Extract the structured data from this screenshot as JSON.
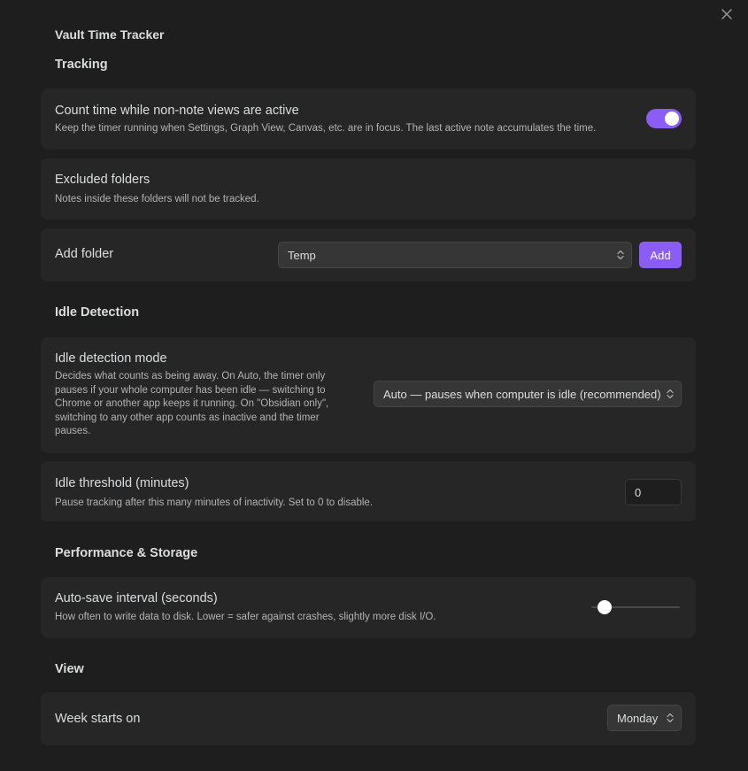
{
  "title": "Vault Time Tracker",
  "sections": {
    "tracking": "Tracking",
    "idle": "Idle Detection",
    "performance": "Performance & Storage",
    "view": "View"
  },
  "settings": {
    "non_note_views": {
      "name": "Count time while non-note views are active",
      "desc": "Keep the timer running when Settings, Graph View, Canvas, etc. are in focus. The last active note accumulates the time.",
      "enabled": true
    },
    "excluded_folders": {
      "name": "Excluded folders",
      "desc": "Notes inside these folders will not be tracked."
    },
    "add_folder": {
      "name": "Add folder",
      "selected": "Temp",
      "button": "Add"
    },
    "idle_mode": {
      "name": "Idle detection mode",
      "desc_lines": [
        "Decides what counts as being away. On Auto, the timer only",
        "pauses if your whole computer has been idle — switching to",
        "Chrome or another app keeps it running. On \"Obsidian only\",",
        "switching to any other app counts as inactive and the timer",
        "pauses."
      ],
      "selected": "Auto — pauses when computer is idle (recommended)"
    },
    "idle_threshold": {
      "name": "Idle threshold (minutes)",
      "desc": "Pause tracking after this many minutes of inactivity. Set to 0 to disable.",
      "value": "0"
    },
    "autosave": {
      "name": "Auto-save interval (seconds)",
      "desc": "How often to write data to disk. Lower = safer against crashes, slightly more disk I/O.",
      "slider_position": 0.15
    },
    "week_start": {
      "name": "Week starts on",
      "selected": "Monday"
    }
  },
  "colors": {
    "accent": "#8b5cf6",
    "background": "#1e1e1e",
    "card": "#262626"
  }
}
